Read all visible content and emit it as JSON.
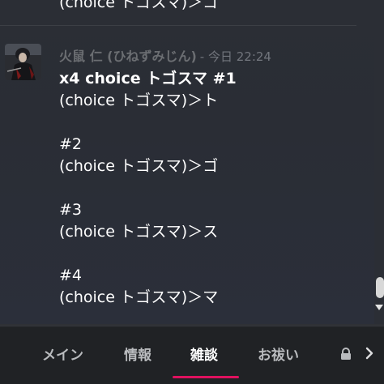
{
  "previous_message": {
    "last_line": "(choice トゴスマ)＞ゴ"
  },
  "message": {
    "author": "火鼠 仁 (ひねずみじん)",
    "timestamp": "- 今日 22:24",
    "lines": [
      "x4 choice トゴスマ #1",
      "(choice トゴスマ)＞ト",
      "",
      "#2",
      "(choice トゴスマ)＞ゴ",
      "",
      "#3",
      "(choice トゴスマ)＞ス",
      "",
      "#4",
      "(choice トゴスマ)＞マ"
    ]
  },
  "tabs": [
    {
      "label": "メイン",
      "active": false
    },
    {
      "label": "情報",
      "active": false
    },
    {
      "label": "雑談",
      "active": true
    },
    {
      "label": "お祓い",
      "active": false
    }
  ],
  "icons": {
    "tab_overflow": "lock-icon",
    "tab_next": "chevron-right-icon",
    "scroll_down": "scroll-down-arrow-icon"
  },
  "colors": {
    "active_tab_underline": "#e0115f",
    "background": "#2b2e35",
    "tabbar": "#202225"
  }
}
